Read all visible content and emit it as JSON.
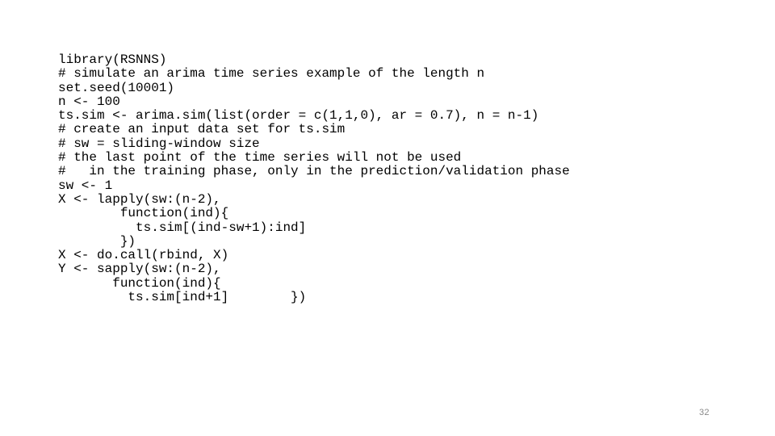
{
  "slide": {
    "background_color": "#ffffff",
    "text_color": "#000000",
    "page_number": "32",
    "page_number_color": "#8a8a8a"
  },
  "code": {
    "language": "R",
    "lines": [
      "library(RSNNS)",
      "# simulate an arima time series example of the length n",
      "set.seed(10001)",
      "n <- 100",
      "ts.sim <- arima.sim(list(order = c(1,1,0), ar = 0.7), n = n-1)",
      "# create an input data set for ts.sim",
      "# sw = sliding-window size",
      "# the last point of the time series will not be used",
      "#   in the training phase, only in the prediction/validation phase",
      "sw <- 1",
      "X <- lapply(sw:(n-2),",
      "        function(ind){",
      "          ts.sim[(ind-sw+1):ind]",
      "        })",
      "X <- do.call(rbind, X)",
      "Y <- sapply(sw:(n-2),",
      "       function(ind){",
      "         ts.sim[ind+1]        })"
    ]
  }
}
